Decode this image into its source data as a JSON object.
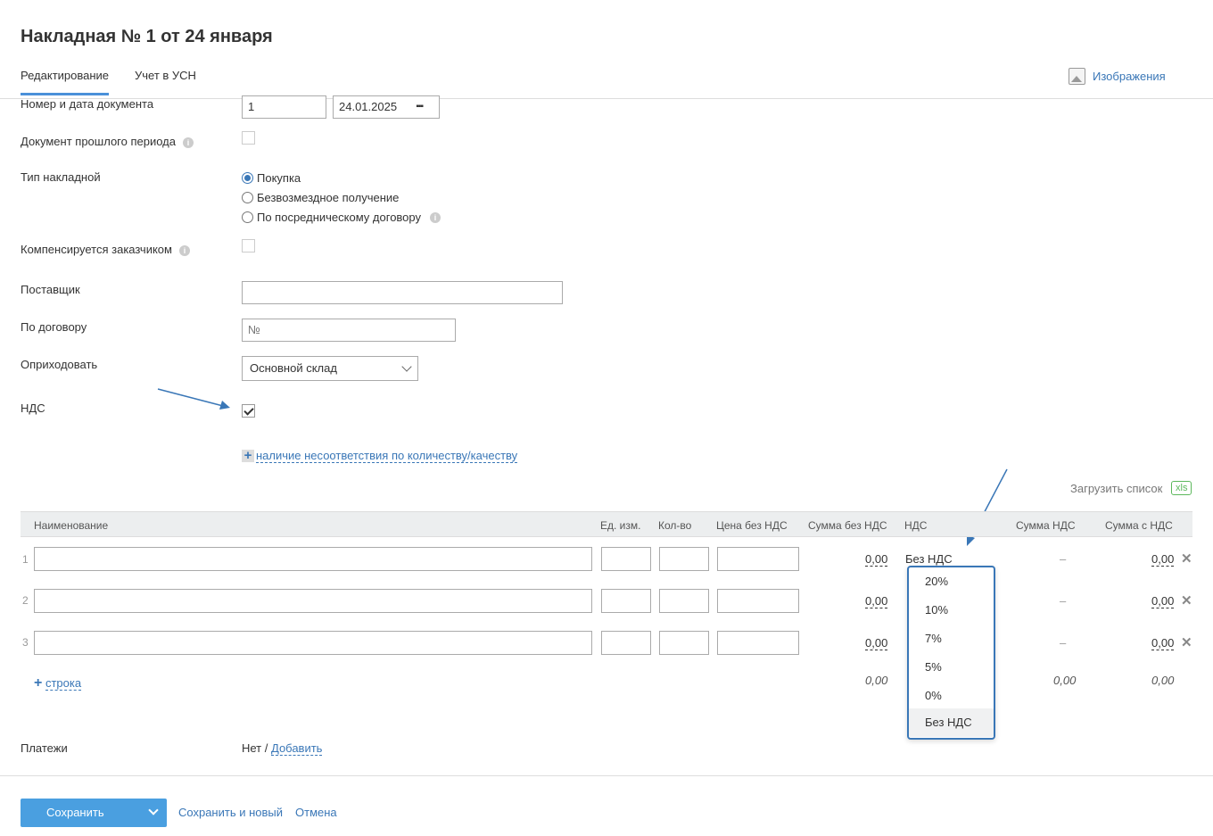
{
  "page": {
    "title": "Накладная № 1 от 24 января",
    "tabs": [
      "Редактирование",
      "Учет в УСН"
    ],
    "images_link": "Изображения"
  },
  "form": {
    "doc_number_label": "Номер и дата документа",
    "doc_number": "1",
    "doc_date": "24.01.2025",
    "prev_period_label": "Документ прошлого периода",
    "type_label": "Тип накладной",
    "type_options": [
      "Покупка",
      "Безвозмездное получение",
      "По посредническому договору"
    ],
    "type_selected": "Покупка",
    "compensated_label": "Компенсируется заказчиком",
    "supplier_label": "Поставщик",
    "supplier_value": "",
    "contract_label": "По договору",
    "contract_placeholder": "№",
    "warehouse_label": "Оприходовать",
    "warehouse_value": "Основной склад",
    "vat_label": "НДС",
    "vat_checked": true,
    "discrepancy_link": "наличие несоответствия по количеству/качеству",
    "payments_label": "Платежи",
    "payments_none": "Нет /",
    "payments_add": "Добавить"
  },
  "table": {
    "upload_label": "Загрузить список",
    "upload_badge": "xls",
    "headers": [
      "Наименование",
      "Ед. изм.",
      "Кол-во",
      "Цена без НДС",
      "Сумма без НДС",
      "НДС",
      "Сумма НДС",
      "Сумма с НДС"
    ],
    "rows": [
      {
        "num": "1",
        "sum_no_vat": "0,00",
        "vat": "Без НДС",
        "vat_sum": "–",
        "sum_vat": "0,00"
      },
      {
        "num": "2",
        "sum_no_vat": "0,00",
        "vat": "",
        "vat_sum": "–",
        "sum_vat": "0,00"
      },
      {
        "num": "3",
        "sum_no_vat": "0,00",
        "vat": "",
        "vat_sum": "–",
        "sum_vat": "0,00"
      }
    ],
    "add_row": "строка",
    "totals": {
      "sum_no_vat": "0,00",
      "vat_sum": "0,00",
      "sum_vat": "0,00"
    }
  },
  "vat_dropdown": {
    "options": [
      "20%",
      "10%",
      "7%",
      "5%",
      "0%",
      "Без НДС"
    ],
    "selected": "Без НДС"
  },
  "footer": {
    "save": "Сохранить",
    "save_new": "Сохранить и новый",
    "cancel": "Отмена"
  },
  "colors": {
    "accent": "#3a77b7",
    "button": "#4a9fe0",
    "xls": "#5cb85c"
  }
}
